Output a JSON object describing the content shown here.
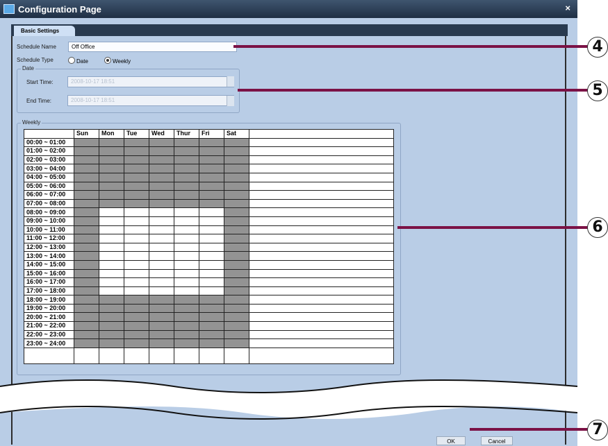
{
  "window": {
    "title": "Configuration Page",
    "close_glyph": "×"
  },
  "tabs": [
    {
      "label": "Basic Settings"
    }
  ],
  "schedule": {
    "name_label": "Schedule Name",
    "name_value": "Off Office",
    "type_label": "Schedule Type",
    "type_options": [
      "Date",
      "Weekly"
    ],
    "type_selected": "Weekly"
  },
  "date_group": {
    "label": "Date",
    "start_label": "Start Time:",
    "start_value": "2008-10-17 18:51",
    "end_label": "End Time:",
    "end_value": "2008-10-17 18:51"
  },
  "weekly": {
    "label": "Weekly",
    "days": [
      "Sun",
      "Mon",
      "Tue",
      "Wed",
      "Thur",
      "Fri",
      "Sat"
    ],
    "hours": [
      "00:00 ~ 01:00",
      "01:00 ~ 02:00",
      "02:00 ~ 03:00",
      "03:00 ~ 04:00",
      "04:00 ~ 05:00",
      "05:00 ~ 06:00",
      "06:00 ~ 07:00",
      "07:00 ~ 08:00",
      "08:00 ~ 09:00",
      "09:00 ~ 10:00",
      "10:00 ~ 11:00",
      "11:00 ~ 12:00",
      "12:00 ~ 13:00",
      "13:00 ~ 14:00",
      "14:00 ~ 15:00",
      "15:00 ~ 16:00",
      "16:00 ~ 17:00",
      "17:00 ~ 18:00",
      "18:00 ~ 19:00",
      "19:00 ~ 20:00",
      "20:00 ~ 21:00",
      "21:00 ~ 22:00",
      "22:00 ~ 23:00",
      "23:00 ~ 24:00"
    ],
    "selected_color": "#939393",
    "weekday_unselected_hours": [
      8,
      17
    ],
    "weekday_indexes": [
      1,
      2,
      3,
      4,
      5
    ]
  },
  "buttons": {
    "ok": "OK",
    "cancel": "Cancel"
  },
  "callouts": [
    "4",
    "5",
    "6",
    "7"
  ],
  "colors": {
    "callout": "#7b1246",
    "window_bg": "#b9cde6",
    "titlebar": "#1f2f44"
  }
}
